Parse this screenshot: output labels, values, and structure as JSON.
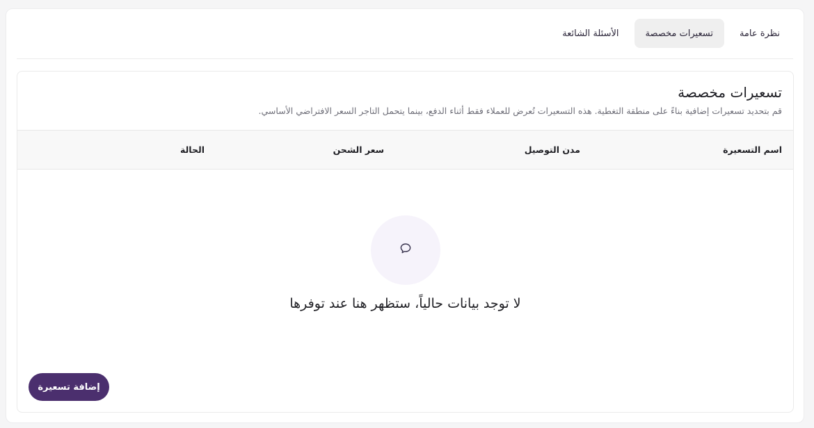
{
  "tabs": [
    {
      "label": "نظرة عامة",
      "active": false
    },
    {
      "label": "تسعيرات مخصصة",
      "active": true
    },
    {
      "label": "الأسئلة الشائعة",
      "active": false
    }
  ],
  "section": {
    "title": "تسعيرات مخصصة",
    "description": "قم بتحديد تسعيرات إضافية بناءً على منطقة التغطية. هذه التسعيرات تُعرض للعملاء فقط أثناء الدفع، بينما يتحمل التاجر السعر الافتراضي الأساسي."
  },
  "table": {
    "columns": [
      "اسم التسعيرة",
      "مدن التوصيل",
      "سعر الشحن",
      "الحالة"
    ]
  },
  "empty_state": {
    "icon": "chat-bubble-icon",
    "message": "لا توجد بيانات حالياً، ستظهر هنا عند توفرها"
  },
  "actions": {
    "add_label": "إضافة تسعيرة"
  },
  "colors": {
    "brand": "#4b2f6e",
    "empty_circle": "#f6f3fb",
    "header_bg": "#f8f8f8"
  }
}
